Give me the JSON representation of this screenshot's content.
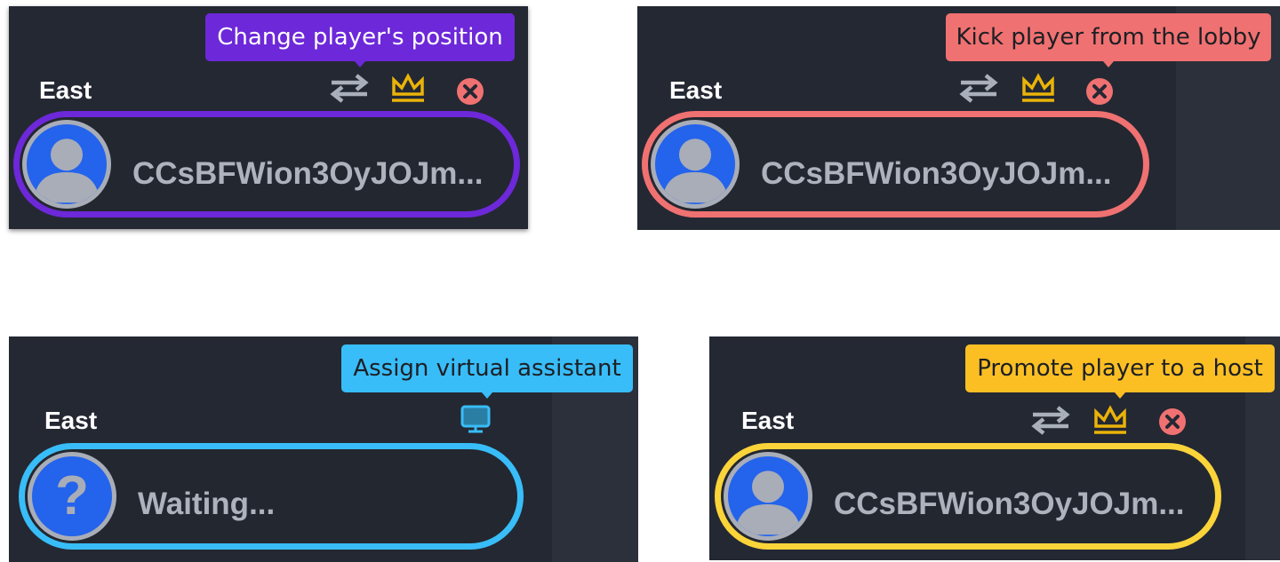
{
  "colors": {
    "panel_bg": "#242833",
    "purple": "#6d28d9",
    "coral": "#f07171",
    "sky": "#38bdf8",
    "amber": "#fbbf24",
    "crown_gold": "#eab308",
    "kick_red": "#f07171",
    "swap_gray": "#aab0bb",
    "avatar_blue": "#2463eb"
  },
  "panels": [
    {
      "seat_label": "East",
      "tooltip": "Change player's position",
      "player_name": "CCsBFWion3OyJOJm...",
      "actions": [
        "swap-icon",
        "crown-icon",
        "kick-icon"
      ]
    },
    {
      "seat_label": "East",
      "tooltip": "Kick player from the lobby",
      "player_name": "CCsBFWion3OyJOJm...",
      "actions": [
        "swap-icon",
        "crown-icon",
        "kick-icon"
      ]
    },
    {
      "seat_label": "East",
      "tooltip": "Assign virtual assistant",
      "player_name": "Waiting...",
      "avatar_glyph": "?",
      "actions": [
        "monitor-icon"
      ]
    },
    {
      "seat_label": "East",
      "tooltip": "Promote player to a host",
      "player_name": "CCsBFWion3OyJOJm...",
      "actions": [
        "swap-icon",
        "crown-icon",
        "kick-icon"
      ]
    }
  ]
}
